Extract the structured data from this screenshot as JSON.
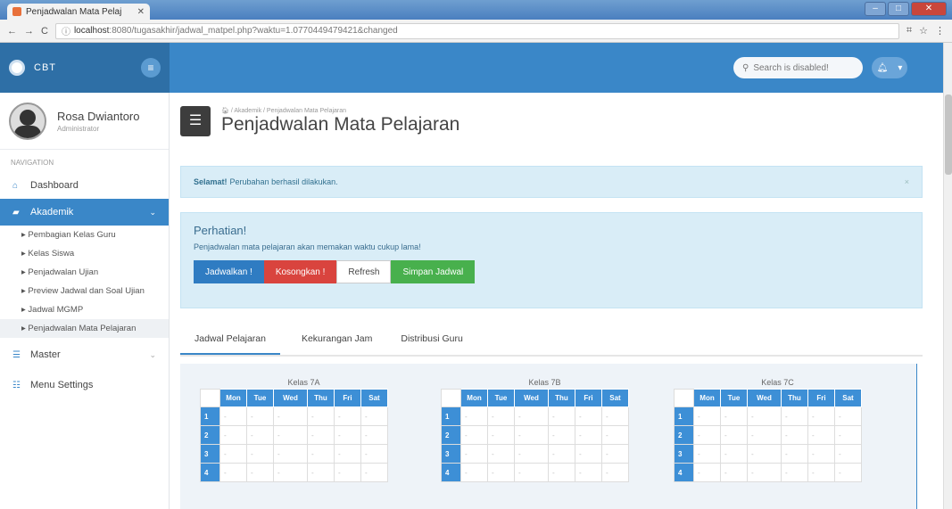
{
  "browser": {
    "tab_title": "Penjadwalan Mata Pelaj",
    "url_host": "localhost",
    "url_rest": ":8080/tugasakhir/jadwal_matpel.php?waktu=1.0770449479421&changed"
  },
  "navbar": {
    "brand": "CBT",
    "search_placeholder": "Search is disabled!"
  },
  "user": {
    "name": "Rosa Dwiantoro",
    "role": "Administrator"
  },
  "sidebar": {
    "nav_label": "NAVIGATION",
    "dashboard": "Dashboard",
    "akademik": "Akademik",
    "sub_items": [
      "Pembagian Kelas Guru",
      "Kelas Siswa",
      "Penjadwalan Ujian",
      "Preview Jadwal dan Soal Ujian",
      "Jadwal MGMP",
      "Penjadwalan Mata Pelajaran"
    ],
    "master": "Master",
    "menu_settings": "Menu Settings"
  },
  "page": {
    "breadcrumb": "Akademik / Penjadwalan Mata Pelajaran",
    "title": "Penjadwalan Mata Pelajaran"
  },
  "alert": {
    "bold": "Selamat!",
    "text": "Perubahan berhasil dilakukan."
  },
  "panel": {
    "title": "Perhatian!",
    "text": "Penjadwalan mata pelajaran akan memakan waktu cukup lama!",
    "btn_jadwalkan": "Jadwalkan !",
    "btn_kosongkan": "Kosongkan !",
    "btn_refresh": "Refresh",
    "btn_simpan": "Simpan Jadwal"
  },
  "tabs": [
    "Jadwal Pelajaran",
    "Kekurangan Jam",
    "Distribusi Guru"
  ],
  "schedule": {
    "days": [
      "Mon",
      "Tue",
      "Wed",
      "Thu",
      "Fri",
      "Sat"
    ],
    "classes": [
      "Kelas 7A",
      "Kelas 7B",
      "Kelas 7C"
    ],
    "rows": [
      "1",
      "2",
      "3",
      "4"
    ],
    "empty": "-"
  },
  "colors": {
    "primary": "#3a87c8",
    "danger": "#d9443e",
    "success": "#48b04d"
  }
}
